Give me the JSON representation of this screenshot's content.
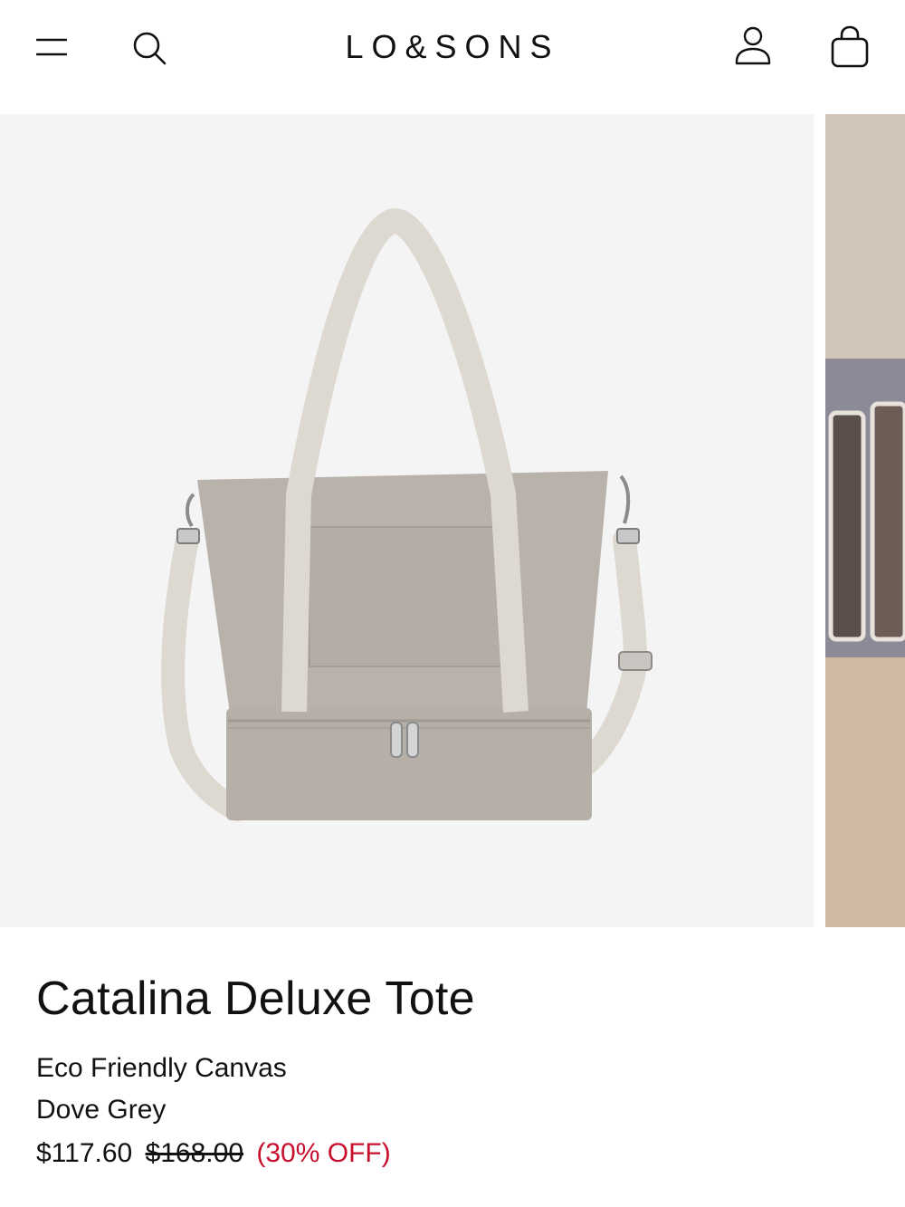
{
  "header": {
    "logo": "LO&SONS",
    "icons": {
      "menu": "hamburger-menu-icon",
      "search": "search-icon",
      "account": "user-account-icon",
      "bag": "shopping-bag-icon"
    }
  },
  "gallery": {
    "slides": [
      "tote-bag-product-photo",
      "lifestyle-photo-partial"
    ]
  },
  "product": {
    "title": "Catalina Deluxe Tote",
    "material": "Eco Friendly Canvas",
    "color": "Dove Grey",
    "price_sale": "$117.60",
    "price_original": "$168.00",
    "discount": "(30% OFF)"
  },
  "colors": {
    "discount_red": "#c8102e",
    "text": "#111111",
    "image_bg": "#f4f4f4"
  }
}
